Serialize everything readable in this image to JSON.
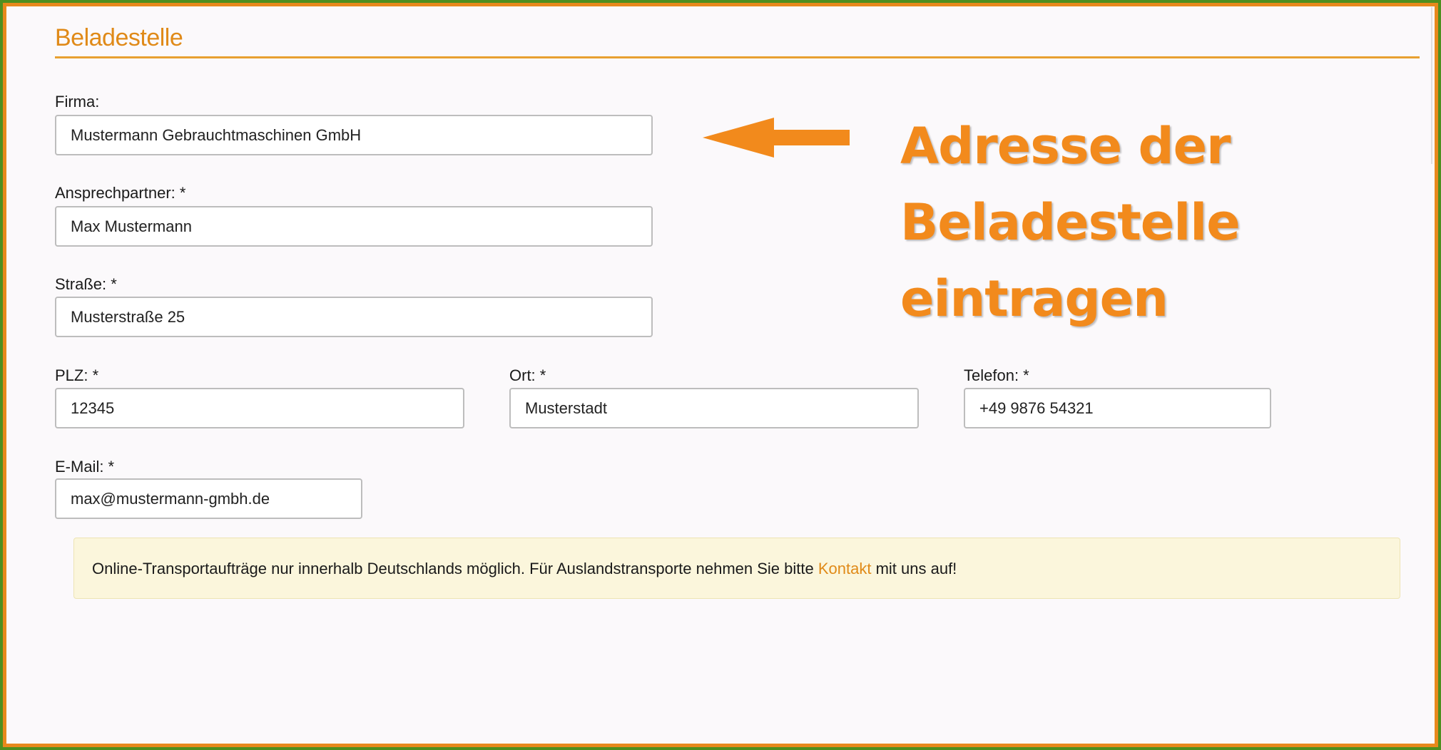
{
  "section": {
    "title": "Beladestelle"
  },
  "fields": {
    "firma": {
      "label": "Firma:",
      "value": "Mustermann Gebrauchtmaschinen GmbH"
    },
    "ansprechpartner": {
      "label": "Ansprechpartner: *",
      "value": "Max Mustermann"
    },
    "strasse": {
      "label": "Straße: *",
      "value": "Musterstraße 25"
    },
    "plz": {
      "label": "PLZ: *",
      "value": "12345"
    },
    "ort": {
      "label": "Ort: *",
      "value": "Musterstadt"
    },
    "telefon": {
      "label": "Telefon: *",
      "value": "+49 9876 54321"
    },
    "email": {
      "label": "E-Mail: *",
      "value": "max@mustermann-gmbh.de"
    }
  },
  "notice": {
    "text_before": "Online-Transportaufträge nur innerhalb Deutschlands möglich. Für Auslandstransporte nehmen Sie bitte ",
    "link": "Kontakt",
    "text_after": " mit uns auf!"
  },
  "callout": {
    "line1": "Adresse der",
    "line2": "Beladestelle",
    "line3": "eintragen"
  },
  "colors": {
    "accent": "#e08a18",
    "frame_orange": "#e8891c",
    "frame_green": "#4e8f1f",
    "notice_bg": "#fbf6dc"
  }
}
